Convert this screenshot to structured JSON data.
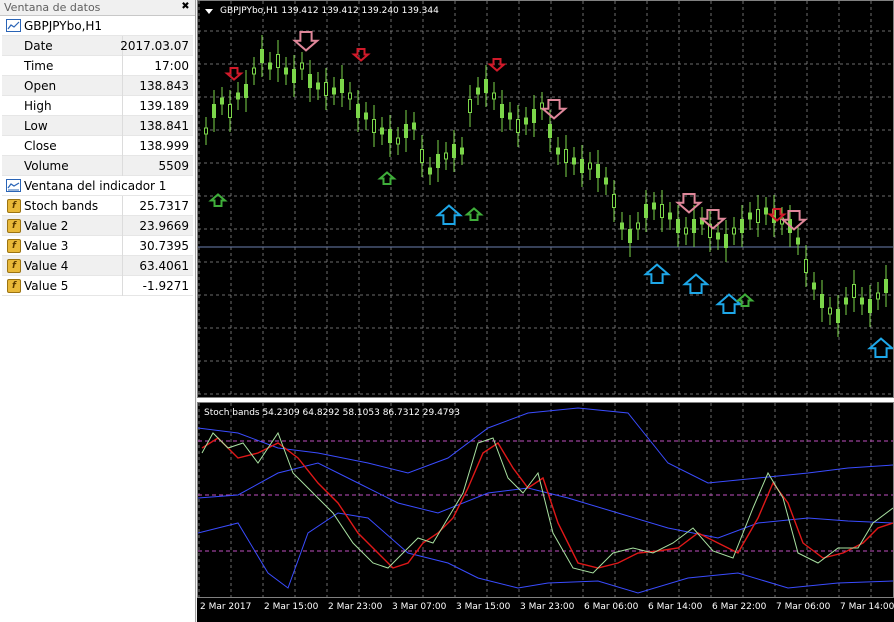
{
  "data_window": {
    "title": "Ventana de datos",
    "close_glyph": "✖",
    "symbol_header": "GBPJPYbo,H1",
    "rows": [
      {
        "label": "Date",
        "value": "2017.03.07"
      },
      {
        "label": "Time",
        "value": "17:00"
      },
      {
        "label": "Open",
        "value": "138.843"
      },
      {
        "label": "High",
        "value": "139.189"
      },
      {
        "label": "Low",
        "value": "138.841"
      },
      {
        "label": "Close",
        "value": "138.999"
      },
      {
        "label": "Volume",
        "value": "5509"
      }
    ],
    "indicator_header": "Ventana del indicador 1",
    "indicator_rows": [
      {
        "label": "Stoch bands",
        "value": "25.7317"
      },
      {
        "label": "Value 2",
        "value": "23.9669"
      },
      {
        "label": "Value 3",
        "value": "30.7395"
      },
      {
        "label": "Value 4",
        "value": "63.4061"
      },
      {
        "label": "Value 5",
        "value": "-1.9271"
      }
    ]
  },
  "main_chart": {
    "caption": "GBPJPYbo,H1  139.412 139.412 139.240 139.344",
    "candle_color": "#7cd64a",
    "sell_arrow_color": "#e0879a",
    "sell_small_color": "#d11a2a",
    "buy_arrow_color": "#1ea7e8",
    "buy_small_color": "#3fae3a",
    "grid_color": "#9a9a9a",
    "hline_color": "#6b7fb0"
  },
  "sub_chart": {
    "caption": "Stoch bands 54.2309 64.8292 58.1053 86.7312 29.4793",
    "line_colors": {
      "main": "#e01818",
      "signal": "#a8e0a0",
      "bands": "#3a4cff"
    },
    "level_color": "#c050c0"
  },
  "time_axis": {
    "labels": [
      "2 Mar 2017",
      "2 Mar 15:00",
      "2 Mar 23:00",
      "3 Mar 07:00",
      "3 Mar 15:00",
      "3 Mar 23:00",
      "6 Mar 06:00",
      "6 Mar 14:00",
      "6 Mar 22:00",
      "7 Mar 06:00",
      "7 Mar 14:00"
    ]
  },
  "icons": {
    "symbol_header": "chart-window-icon",
    "indicator_header": "indicator-window-icon",
    "indicator_row": "function-icon"
  }
}
